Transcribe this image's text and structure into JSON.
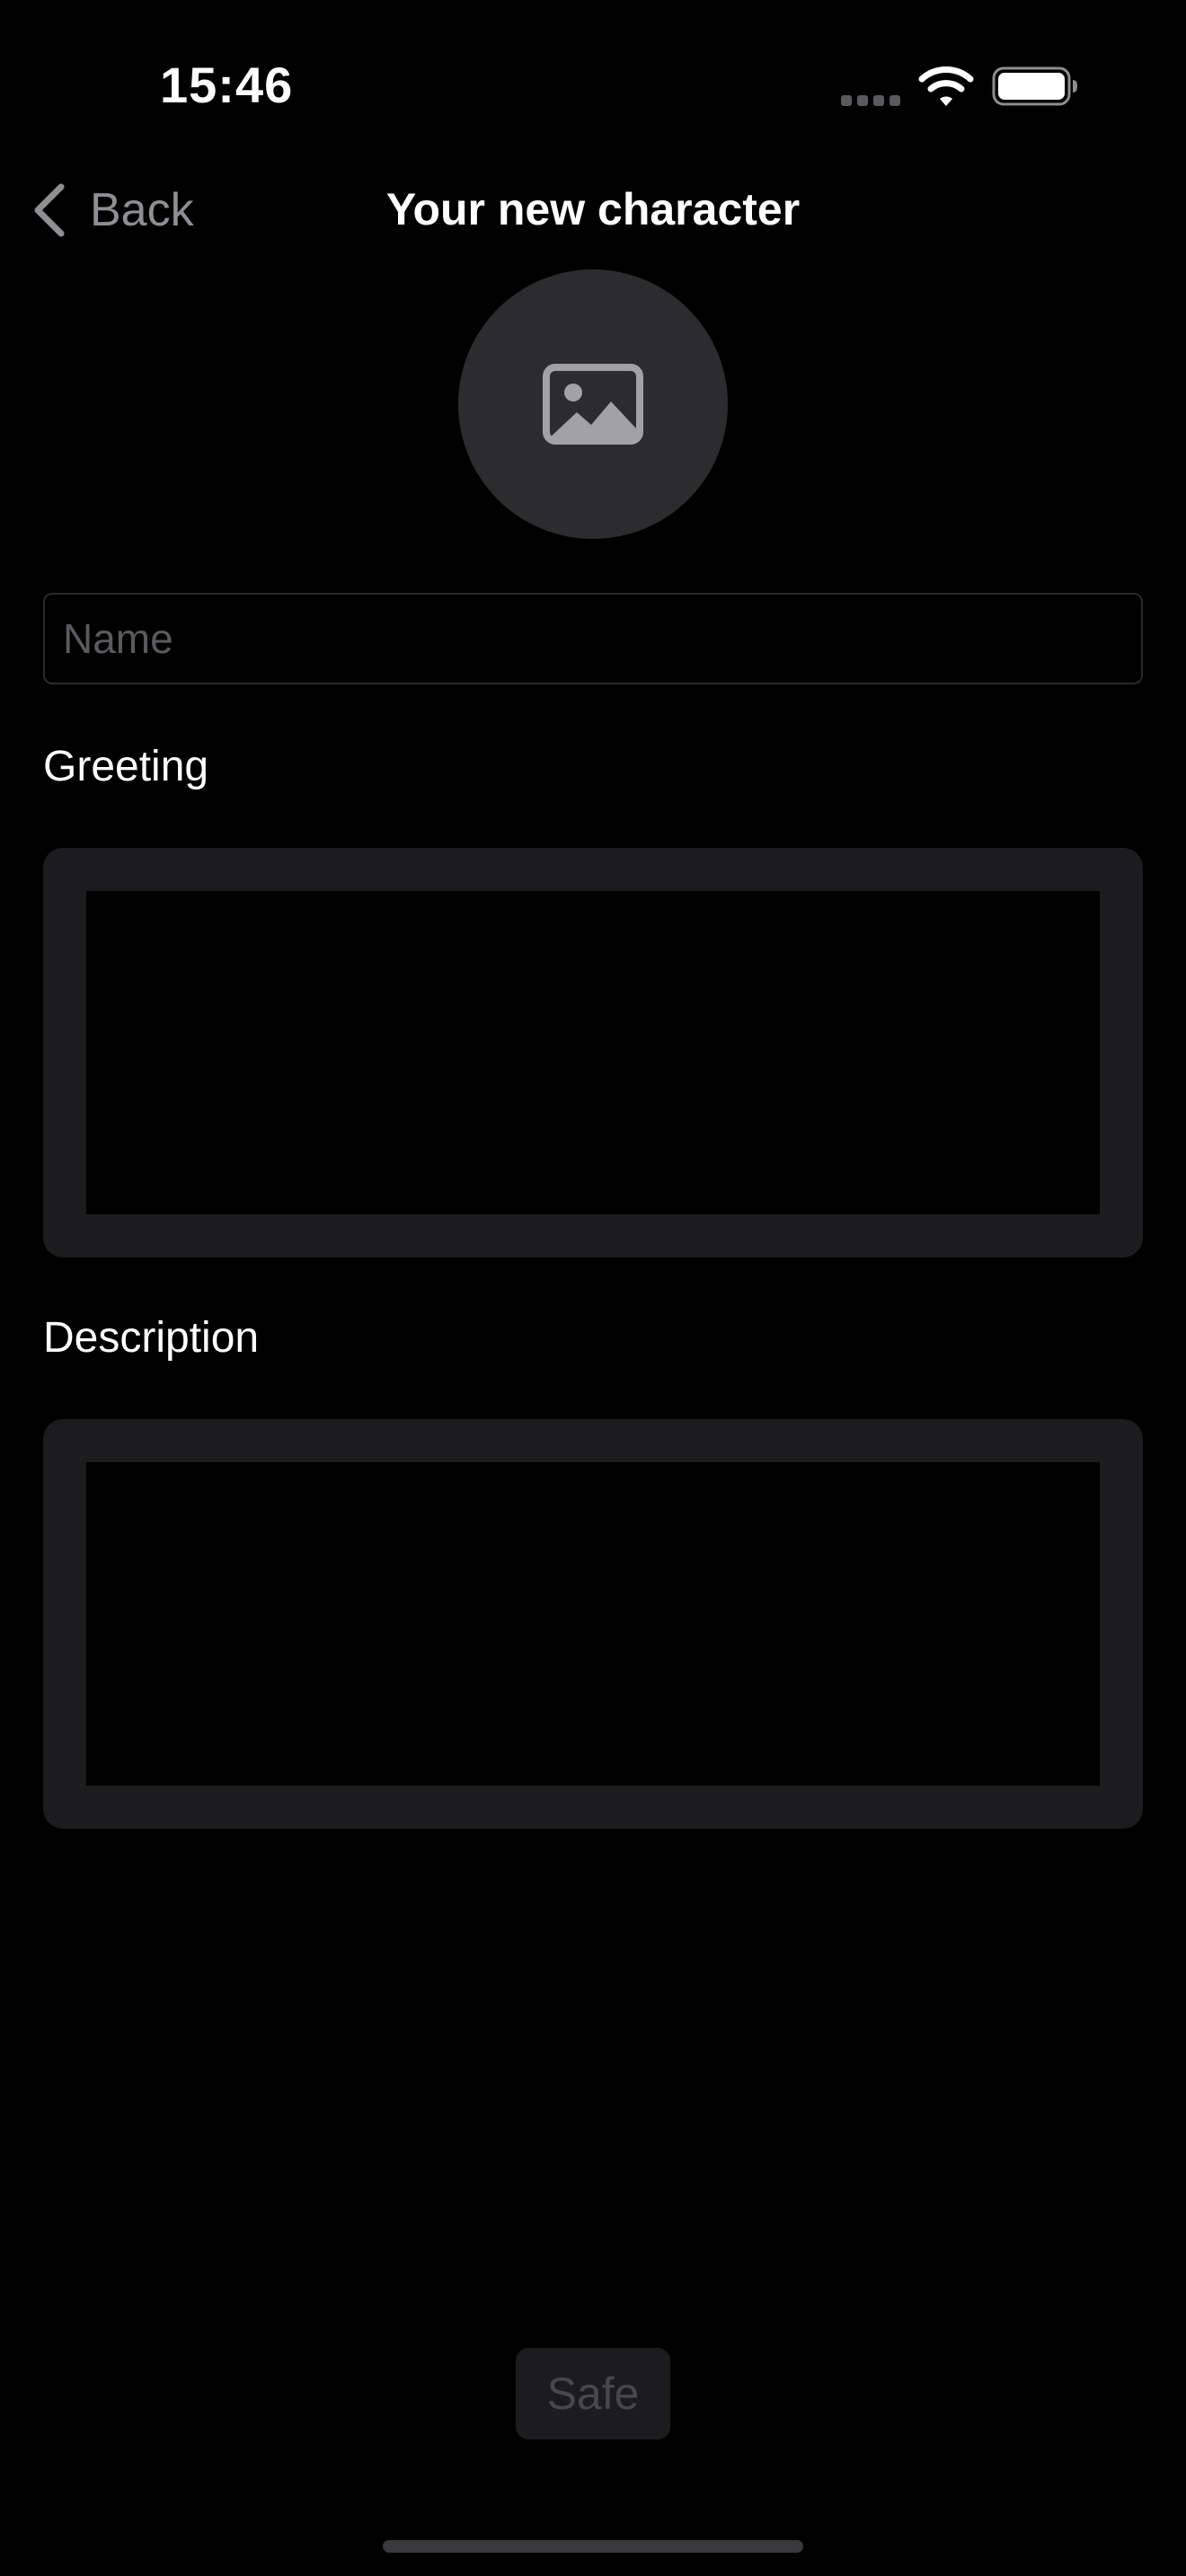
{
  "status_bar": {
    "time": "15:46",
    "icons": [
      "signal-dots-icon",
      "wifi-icon",
      "battery-icon"
    ]
  },
  "nav": {
    "back_label": "Back",
    "back_icon": "chevron-left-icon",
    "title": "Your new character"
  },
  "avatar": {
    "icon": "photo-icon"
  },
  "form": {
    "name_placeholder": "Name",
    "name_value": "",
    "greeting_label": "Greeting",
    "greeting_value": "",
    "description_label": "Description",
    "description_value": ""
  },
  "actions": {
    "save_label": "Safe",
    "save_enabled": false
  },
  "colors": {
    "background": "#000000",
    "secondary_text": "#8e8e93",
    "surface": "#1c1c1e",
    "avatar_fill": "#2c2c2e",
    "disabled_text": "#48484a"
  }
}
